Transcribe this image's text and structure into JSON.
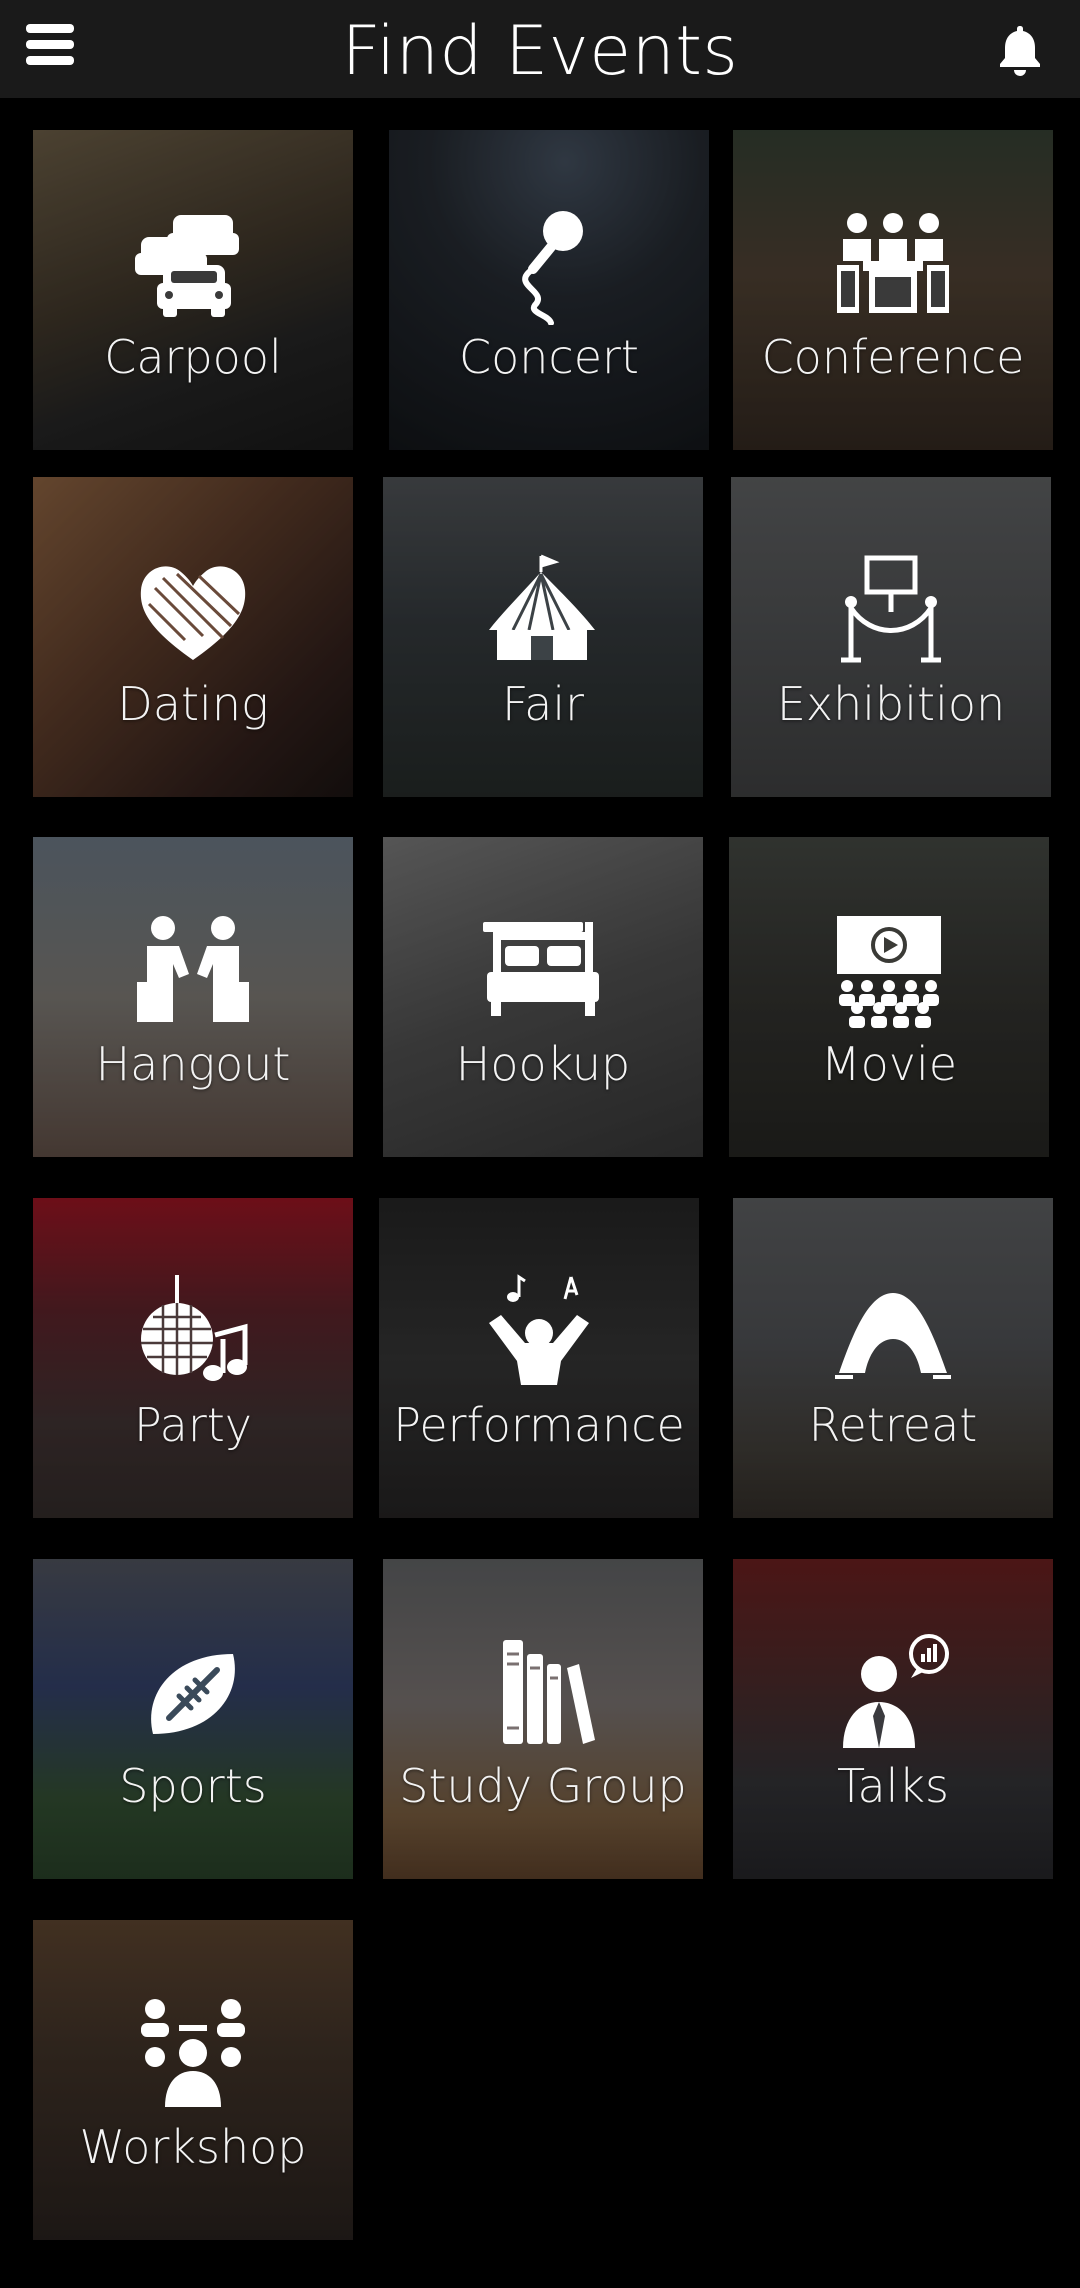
{
  "header": {
    "title": "Find Events",
    "menu_icon": "hamburger-menu-icon",
    "notification_icon": "bell-icon"
  },
  "categories": [
    {
      "label": "Carpool",
      "icon": "cars-icon"
    },
    {
      "label": "Concert",
      "icon": "microphone-icon"
    },
    {
      "label": "Conference",
      "icon": "meeting-table-icon"
    },
    {
      "label": "Dating",
      "icon": "heart-icon"
    },
    {
      "label": "Fair",
      "icon": "circus-tent-icon"
    },
    {
      "label": "Exhibition",
      "icon": "exhibit-stanchion-icon"
    },
    {
      "label": "Hangout",
      "icon": "two-people-chatting-icon"
    },
    {
      "label": "Hookup",
      "icon": "bed-icon"
    },
    {
      "label": "Movie",
      "icon": "cinema-audience-icon"
    },
    {
      "label": "Party",
      "icon": "disco-ball-icon"
    },
    {
      "label": "Performance",
      "icon": "performer-icon"
    },
    {
      "label": "Retreat",
      "icon": "dome-tent-icon"
    },
    {
      "label": "Sports",
      "icon": "football-icon"
    },
    {
      "label": "Study Group",
      "icon": "books-icon"
    },
    {
      "label": "Talks",
      "icon": "speaker-icon"
    },
    {
      "label": "Workshop",
      "icon": "group-workshop-icon"
    }
  ]
}
